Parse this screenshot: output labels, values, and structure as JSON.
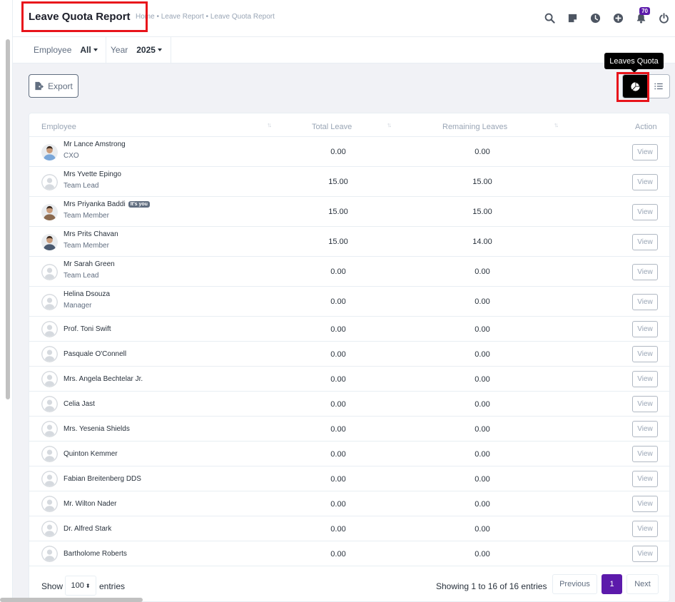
{
  "header": {
    "title": "Leave Quota Report",
    "breadcrumb": "Home • Leave Report • Leave Quota Report",
    "notification_count": "70",
    "icons": [
      "search-icon",
      "sticky-note-icon",
      "clock-icon",
      "plus-circle-icon",
      "bell-icon",
      "power-icon"
    ]
  },
  "filters": {
    "employee_label": "Employee",
    "employee_value": "All",
    "year_label": "Year",
    "year_value": "2025"
  },
  "toolbar": {
    "export_label": "Export",
    "tooltip": "Leaves Quota"
  },
  "table": {
    "columns": [
      "Employee",
      "Total Leave",
      "Remaining Leaves",
      "Action"
    ],
    "view_label": "View",
    "you_badge": "It's you",
    "rows": [
      {
        "name": "Mr Lance Amstrong",
        "role": "CXO",
        "total": "0.00",
        "remaining": "0.00",
        "avatar": "photo"
      },
      {
        "name": "Mrs Yvette Epingo",
        "role": "Team Lead",
        "total": "15.00",
        "remaining": "15.00",
        "avatar": "default"
      },
      {
        "name": "Mrs Priyanka Baddi",
        "role": "Team Member",
        "total": "15.00",
        "remaining": "15.00",
        "avatar": "photo",
        "you": true
      },
      {
        "name": "Mrs Prits Chavan",
        "role": "Team Member",
        "total": "15.00",
        "remaining": "14.00",
        "avatar": "photo"
      },
      {
        "name": "Mr Sarah Green",
        "role": "Team Lead",
        "total": "0.00",
        "remaining": "0.00",
        "avatar": "default"
      },
      {
        "name": "Helina Dsouza",
        "role": "Manager",
        "total": "0.00",
        "remaining": "0.00",
        "avatar": "default"
      },
      {
        "name": "Prof. Toni Swift",
        "role": "",
        "total": "0.00",
        "remaining": "0.00",
        "avatar": "default"
      },
      {
        "name": "Pasquale O'Connell",
        "role": "",
        "total": "0.00",
        "remaining": "0.00",
        "avatar": "default"
      },
      {
        "name": "Mrs. Angela Bechtelar Jr.",
        "role": "",
        "total": "0.00",
        "remaining": "0.00",
        "avatar": "default"
      },
      {
        "name": "Celia Jast",
        "role": "",
        "total": "0.00",
        "remaining": "0.00",
        "avatar": "default"
      },
      {
        "name": "Mrs. Yesenia Shields",
        "role": "",
        "total": "0.00",
        "remaining": "0.00",
        "avatar": "default"
      },
      {
        "name": "Quinton Kemmer",
        "role": "",
        "total": "0.00",
        "remaining": "0.00",
        "avatar": "default"
      },
      {
        "name": "Fabian Breitenberg DDS",
        "role": "",
        "total": "0.00",
        "remaining": "0.00",
        "avatar": "default"
      },
      {
        "name": "Mr. Wilton Nader",
        "role": "",
        "total": "0.00",
        "remaining": "0.00",
        "avatar": "default"
      },
      {
        "name": "Dr. Alfred Stark",
        "role": "",
        "total": "0.00",
        "remaining": "0.00",
        "avatar": "default"
      },
      {
        "name": "Bartholome Roberts",
        "role": "",
        "total": "0.00",
        "remaining": "0.00",
        "avatar": "default"
      }
    ]
  },
  "footer": {
    "show_label": "Show",
    "page_size": "100",
    "entries_label": "entries",
    "showing_text": "Showing 1 to 16 of 16 entries",
    "previous_label": "Previous",
    "current_page": "1",
    "next_label": "Next"
  },
  "colors": {
    "accent": "#5c1aab",
    "highlight": "#e8141b"
  }
}
